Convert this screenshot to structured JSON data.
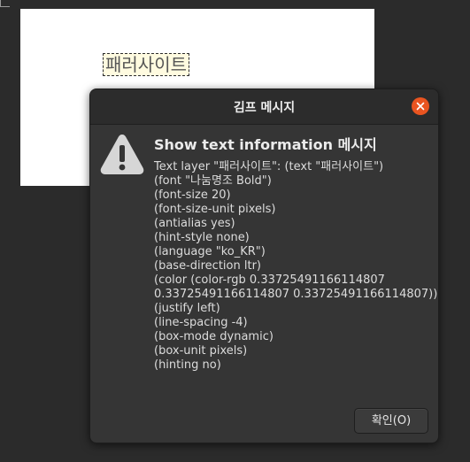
{
  "canvas": {
    "text_layer": "패러사이트"
  },
  "dialog": {
    "title": "김프 메시지",
    "close_icon": "close-icon",
    "warning_icon": "warning-icon",
    "heading": "Show text information 메시지",
    "message_lines": [
      "Text layer \"패러사이트\": (text \"패러사이트\")",
      "(font \"나눔명조 Bold\")",
      "(font-size 20)",
      "(font-size-unit pixels)",
      "(antialias yes)",
      "(hint-style none)",
      "(language \"ko_KR\")",
      "(base-direction ltr)",
      "(color (color-rgb 0.33725491166114807",
      "0.33725491166114807 0.33725491166114807))",
      "(justify left)",
      "(line-spacing -4)",
      "(box-mode dynamic)",
      "(box-unit pixels)",
      "(hinting no)"
    ],
    "ok_label": "확인(O)"
  },
  "colors": {
    "accent_close": "#e95420",
    "dialog_bg": "#353535",
    "titlebar_bg": "#2c2c2c",
    "workspace_bg": "#2b2b2b",
    "text_color_sample": "#565656"
  }
}
